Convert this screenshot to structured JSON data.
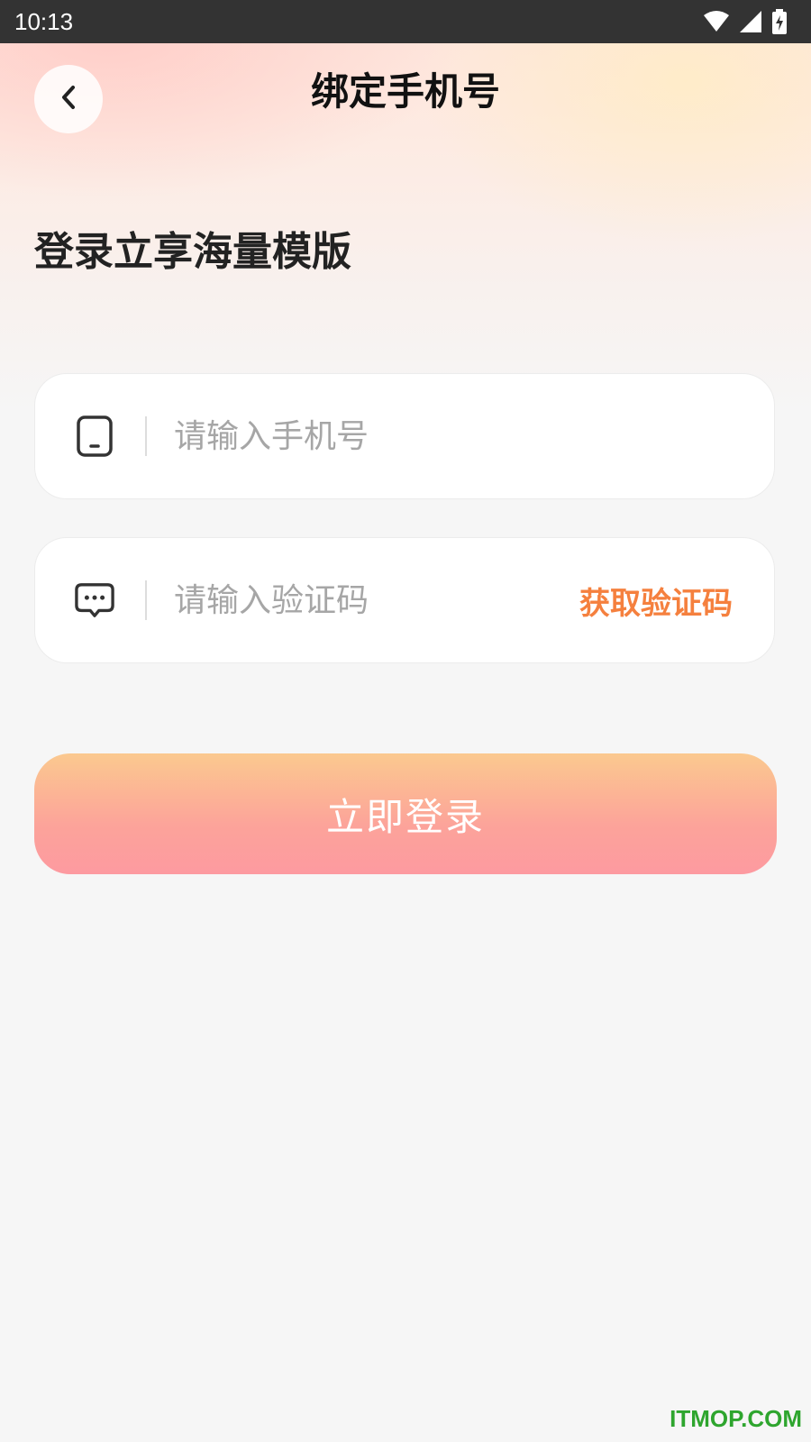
{
  "status_bar": {
    "time": "10:13",
    "icons": [
      "wifi-icon",
      "cell-signal-icon",
      "battery-charging-icon"
    ]
  },
  "header": {
    "title": "绑定手机号",
    "back_icon": "chevron-left-icon"
  },
  "promo": {
    "heading": "登录立享海量模版"
  },
  "form": {
    "phone": {
      "icon": "phone-icon",
      "placeholder": "请输入手机号",
      "value": ""
    },
    "code": {
      "icon": "message-icon",
      "placeholder": "请输入验证码",
      "value": "",
      "get_code_label": "获取验证码"
    },
    "login_label": "立即登录"
  },
  "watermark": "ITMOP.COM",
  "colors": {
    "accent": "#f5803e",
    "button_top": "#fbc98f",
    "button_bottom": "#fd9aa0",
    "status_bar": "#333333"
  }
}
